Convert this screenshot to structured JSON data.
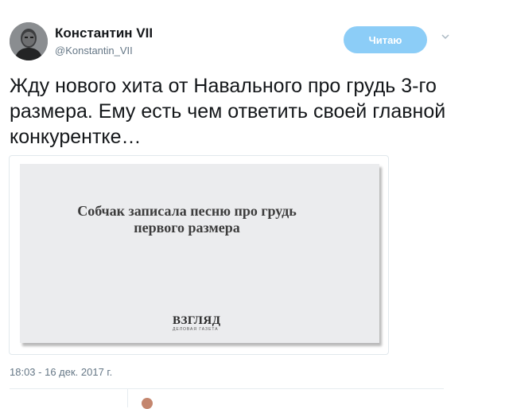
{
  "author": {
    "name": "Константин VII",
    "handle": "@Konstantin_VII"
  },
  "follow_button": {
    "label": "Читаю",
    "color": "#8ccdf7"
  },
  "tweet": {
    "text": "Жду нового хита от Навального про грудь 3-го размера. Ему есть чем ответить своей главной конкурентке…",
    "timestamp": "18:03 - 16 дек. 2017 г."
  },
  "card": {
    "headline": "Собчак записала песню про грудь первого размера",
    "logo": "ВЗГЛЯД",
    "logo_subtitle": "ДЕЛОВАЯ ГАЗЕТА"
  },
  "icons": {
    "avatar": "avatar-photo",
    "caret": "chevron-down-icon"
  }
}
